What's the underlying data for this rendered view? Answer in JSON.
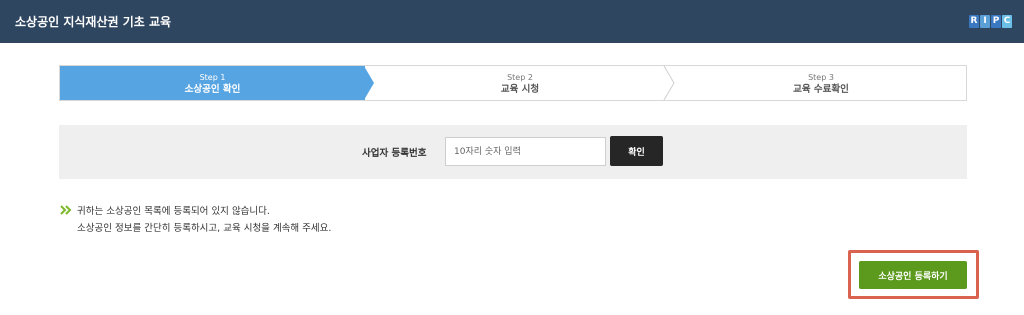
{
  "header": {
    "title": "소상공인 지식재산권 기초 교육",
    "logo_letters": [
      "R",
      "I",
      "P",
      "C"
    ]
  },
  "steps": [
    {
      "number": "Step 1",
      "label": "소상공인 확인",
      "active": true
    },
    {
      "number": "Step 2",
      "label": "교육 시청",
      "active": false
    },
    {
      "number": "Step 3",
      "label": "교육 수료확인",
      "active": false
    }
  ],
  "registration": {
    "label": "사업자 등록번호",
    "placeholder": "10자리 숫자 입력",
    "value": "",
    "confirm_label": "확인"
  },
  "notice": {
    "icon": "double-chevron-right-icon",
    "line1": "귀하는 소상공인 목록에 등록되어 있지 않습니다.",
    "line2": "소상공인 정보를 간단히 등록하시고, 교육 시청을 계속해 주세요."
  },
  "actions": {
    "register_label": "소상공인 등록하기"
  },
  "colors": {
    "header_bg": "#2f4660",
    "active_step": "#57a4e2",
    "confirm_button": "#262626",
    "register_button": "#5b9a1d",
    "highlight_border": "#d9634e",
    "notice_icon": "#7bb82a"
  }
}
